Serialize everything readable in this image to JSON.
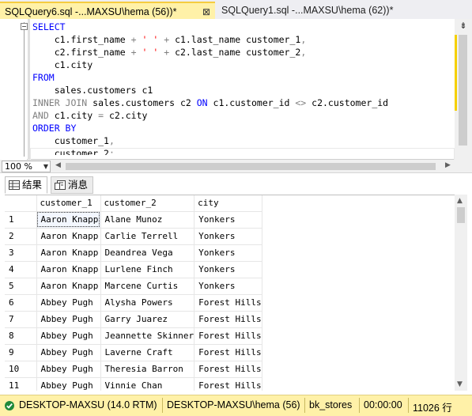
{
  "tabs": {
    "active_label": "SQLQuery6.sql -...MAXSU\\hema (56))*",
    "inactive_label": "SQLQuery1.sql -...MAXSU\\hema (62))*",
    "close_glyph": "⊠"
  },
  "editor": {
    "lines": [
      [
        {
          "t": "SELECT",
          "c": "kw"
        }
      ],
      [
        {
          "t": "    c1.first_name ",
          "c": ""
        },
        {
          "t": "+",
          "c": "gr"
        },
        {
          "t": " ",
          "c": ""
        },
        {
          "t": "' '",
          "c": "st"
        },
        {
          "t": " ",
          "c": ""
        },
        {
          "t": "+",
          "c": "gr"
        },
        {
          "t": " c1.last_name customer_1",
          "c": ""
        },
        {
          "t": ",",
          "c": "gr"
        }
      ],
      [
        {
          "t": "    c2.first_name ",
          "c": ""
        },
        {
          "t": "+",
          "c": "gr"
        },
        {
          "t": " ",
          "c": ""
        },
        {
          "t": "' '",
          "c": "st"
        },
        {
          "t": " ",
          "c": ""
        },
        {
          "t": "+",
          "c": "gr"
        },
        {
          "t": " c2.last_name customer_2",
          "c": ""
        },
        {
          "t": ",",
          "c": "gr"
        }
      ],
      [
        {
          "t": "    c1.city",
          "c": ""
        }
      ],
      [
        {
          "t": "FROM",
          "c": "kw"
        }
      ],
      [
        {
          "t": "    sales.customers c1",
          "c": ""
        }
      ],
      [
        {
          "t": "INNER JOIN",
          "c": "gr"
        },
        {
          "t": " sales.customers c2 ",
          "c": ""
        },
        {
          "t": "ON",
          "c": "kw"
        },
        {
          "t": " c1.customer_id ",
          "c": ""
        },
        {
          "t": "<>",
          "c": "gr"
        },
        {
          "t": " c2.customer_id",
          "c": ""
        }
      ],
      [
        {
          "t": "AND",
          "c": "gr"
        },
        {
          "t": " c1.city ",
          "c": ""
        },
        {
          "t": "=",
          "c": "gr"
        },
        {
          "t": " c2.city",
          "c": ""
        }
      ],
      [
        {
          "t": "ORDER BY",
          "c": "kw"
        }
      ],
      [
        {
          "t": "    customer_1",
          "c": ""
        },
        {
          "t": ",",
          "c": "gr"
        }
      ],
      [
        {
          "t": "    customer_2",
          "c": ""
        },
        {
          "t": ";",
          "c": "gr"
        }
      ]
    ]
  },
  "zoom": {
    "value": "100 %"
  },
  "results_tabs": {
    "results_label": "结果",
    "messages_label": "消息"
  },
  "grid": {
    "columns": [
      "customer_1",
      "customer_2",
      "city"
    ],
    "rows": [
      [
        "1",
        "Aaron Knapp",
        "Alane Munoz",
        "Yonkers"
      ],
      [
        "2",
        "Aaron Knapp",
        "Carlie Terrell",
        "Yonkers"
      ],
      [
        "3",
        "Aaron Knapp",
        "Deandrea Vega",
        "Yonkers"
      ],
      [
        "4",
        "Aaron Knapp",
        "Lurlene Finch",
        "Yonkers"
      ],
      [
        "5",
        "Aaron Knapp",
        "Marcene Curtis",
        "Yonkers"
      ],
      [
        "6",
        "Abbey Pugh",
        "Alysha Powers",
        "Forest Hills"
      ],
      [
        "7",
        "Abbey Pugh",
        "Garry Juarez",
        "Forest Hills"
      ],
      [
        "8",
        "Abbey Pugh",
        "Jeannette Skinner",
        "Forest Hills"
      ],
      [
        "9",
        "Abbey Pugh",
        "Laverne Craft",
        "Forest Hills"
      ],
      [
        "10",
        "Abbey Pugh",
        "Theresia Barron",
        "Forest Hills"
      ],
      [
        "11",
        "Abbey Pugh",
        "Vinnie Chan",
        "Forest Hills"
      ]
    ]
  },
  "status": {
    "server": "DESKTOP-MAXSU (14.0 RTM)",
    "user": "DESKTOP-MAXSU\\hema (56)",
    "database": "bk_stores",
    "elapsed": "00:00:00",
    "rows": "11026 行"
  },
  "colors": {
    "accent": "#f5cc40",
    "status_bg": "#fff1a8",
    "keyword": "#0000ff",
    "string": "#ff0000",
    "operator": "#808080"
  }
}
